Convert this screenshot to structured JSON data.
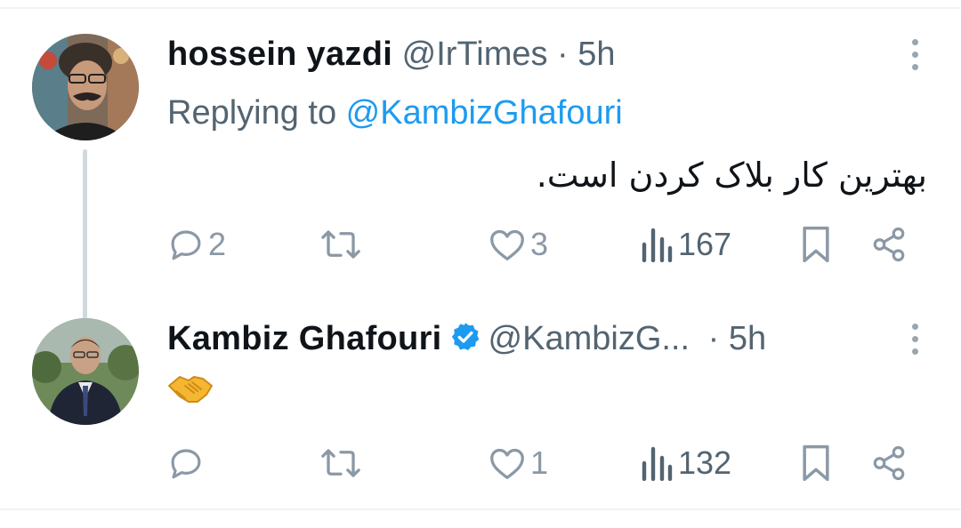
{
  "tweets": [
    {
      "author_name": "hossein yazdi",
      "handle": "@IrTimes",
      "dot": "·",
      "time": "5h",
      "replying_prefix": "Replying to ",
      "replying_to": "@KambizGhafouri",
      "text": "بهترین کار بلاک کردن است.",
      "replies": "2",
      "likes": "3",
      "views": "167"
    },
    {
      "author_name": "Kambiz Ghafouri",
      "verified": true,
      "handle": "@KambizG...",
      "dot": "·",
      "time": "5h",
      "emoji": "handshake",
      "likes": "1",
      "views": "132"
    }
  ],
  "colors": {
    "text": "#0f1419",
    "secondary": "#536471",
    "accent": "#1d9bf0",
    "icon": "#8b98a5",
    "thread_line": "#cfd9de"
  },
  "icons": [
    "more-icon",
    "reply-icon",
    "retweet-icon",
    "like-icon",
    "views-icon",
    "bookmark-icon",
    "share-icon",
    "verified-badge-icon",
    "handshake-emoji"
  ]
}
